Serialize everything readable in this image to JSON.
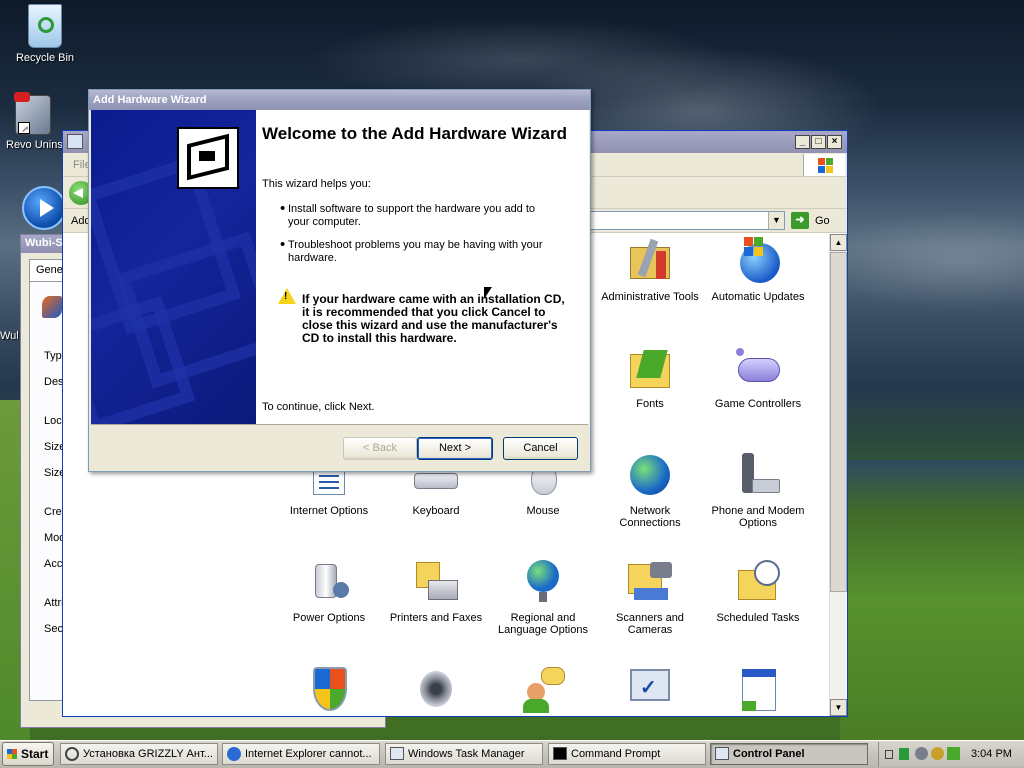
{
  "desktop": {
    "icons": [
      {
        "label": "Recycle Bin"
      },
      {
        "label": "Revo Unins"
      },
      {
        "label": "Wul"
      }
    ]
  },
  "background_windows": {
    "wubi_title": "Wubi-S",
    "wubi_tab": "Gene",
    "wubi_fields": [
      "Typ",
      "Des",
      "Loc",
      "Size",
      "Size",
      "Crea",
      "Mod",
      "Acc",
      "Attri",
      "Sec"
    ]
  },
  "control_panel": {
    "menu_partial": "File",
    "address_partial": "Add",
    "go_label": "Go",
    "title": "Control Panel",
    "items": [
      {
        "label": "Administrative Tools",
        "icon": "administrative-tools-icon"
      },
      {
        "label": "Automatic Updates",
        "icon": "automatic-updates-icon"
      },
      {
        "label": "Fonts",
        "icon": "fonts-icon"
      },
      {
        "label": "Game Controllers",
        "icon": "game-controllers-icon"
      },
      {
        "label": "Internet Options",
        "icon": "internet-options-icon"
      },
      {
        "label": "Keyboard",
        "icon": "keyboard-icon"
      },
      {
        "label": "Mouse",
        "icon": "mouse-icon"
      },
      {
        "label": "Network Connections",
        "icon": "network-connections-icon"
      },
      {
        "label": "Phone and Modem Options",
        "icon": "phone-modem-icon"
      },
      {
        "label": "Power Options",
        "icon": "power-options-icon"
      },
      {
        "label": "Printers and Faxes",
        "icon": "printers-faxes-icon"
      },
      {
        "label": "Regional and Language Options",
        "icon": "regional-language-icon"
      },
      {
        "label": "Scanners and Cameras",
        "icon": "scanners-cameras-icon"
      },
      {
        "label": "Scheduled Tasks",
        "icon": "scheduled-tasks-icon"
      },
      {
        "label": "",
        "icon": "security-center-icon"
      },
      {
        "label": "",
        "icon": "sounds-icon"
      },
      {
        "label": "",
        "icon": "speech-icon"
      },
      {
        "label": "",
        "icon": "system-icon"
      },
      {
        "label": "",
        "icon": "taskbar-start-menu-icon"
      }
    ]
  },
  "wizard": {
    "title": "Add Hardware Wizard",
    "heading": "Welcome to the Add Hardware Wizard",
    "intro": "This wizard helps you:",
    "bullet1": "Install software to support the hardware you add to your computer.",
    "bullet2": "Troubleshoot problems you may be having with your hardware.",
    "warning": "If your hardware came with an installation CD, it is recommended that you click Cancel to close this wizard and use the manufacturer's CD to install this hardware.",
    "continue": "To continue, click Next.",
    "back_label": "< Back",
    "next_label": "Next >",
    "cancel_label": "Cancel"
  },
  "taskbar": {
    "start_label": "Start",
    "buttons": [
      {
        "label": "Установка GRIZZLY Ант..."
      },
      {
        "label": "Internet Explorer cannot..."
      },
      {
        "label": "Windows Task Manager"
      },
      {
        "label": "Command Prompt"
      },
      {
        "label": "Control Panel"
      }
    ],
    "clock": "3:04 PM"
  }
}
